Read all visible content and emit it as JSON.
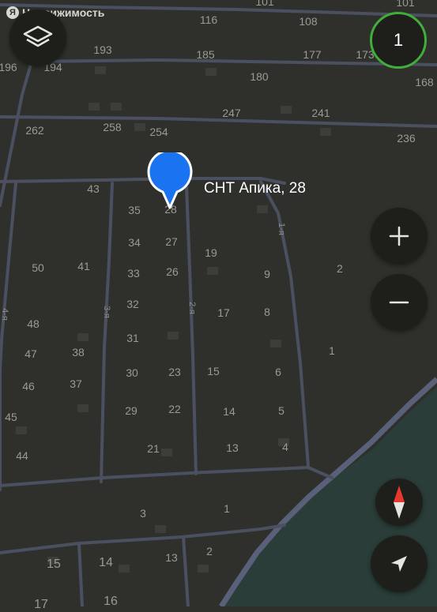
{
  "brand": {
    "logo_letter": "Я",
    "name": "Недвижимость"
  },
  "badge": {
    "count": "1",
    "ring_color": "#3fae3a"
  },
  "pin": {
    "label": "СНТ Апика, 28",
    "color": "#1a73f0"
  },
  "controls": {
    "layers_icon": "layers-icon",
    "zoom_in_icon": "plus-icon",
    "zoom_out_icon": "minus-icon",
    "compass_icon": "compass-icon",
    "locate_icon": "navigation-arrow-icon"
  },
  "streets": [
    "1-я",
    "2-я",
    "3-я",
    "4-я"
  ],
  "plot_numbers": {
    "n101": "101",
    "n116": "116",
    "n108": "108",
    "n193": "193",
    "n185": "185",
    "n177": "177",
    "n173": "173",
    "n196": "196",
    "n194": "194",
    "n180": "180",
    "n168": "168",
    "n247": "247",
    "n241": "241",
    "n262": "262",
    "n258": "258",
    "n254": "254",
    "n236": "236",
    "n43": "43",
    "n35": "35",
    "n28": "28",
    "n34": "34",
    "n27": "27",
    "n19": "19",
    "n2": "2",
    "n50": "50",
    "n41": "41",
    "n33": "33",
    "n26": "26",
    "n9": "9",
    "n32": "32",
    "n48": "48",
    "n17": "17",
    "n8": "8",
    "n31": "31",
    "n47": "47",
    "n38": "38",
    "n1": "1",
    "n30": "30",
    "n23": "23",
    "n15": "15",
    "n6": "6",
    "n46": "46",
    "n37": "37",
    "n29": "29",
    "n22": "22",
    "n14": "14",
    "n5": "5",
    "n45": "45",
    "n21": "21",
    "n13": "13",
    "n4": "4",
    "n44": "44",
    "n3": "3",
    "n1b": "1",
    "n2b": "2",
    "n13b": "13",
    "n15b": "15",
    "n14b": "14",
    "n16": "16",
    "n17b": "17"
  },
  "colors": {
    "land": "#2f302c",
    "water": "#2a3d39",
    "road": "#4b5060",
    "highway": "#5a5f7a"
  }
}
